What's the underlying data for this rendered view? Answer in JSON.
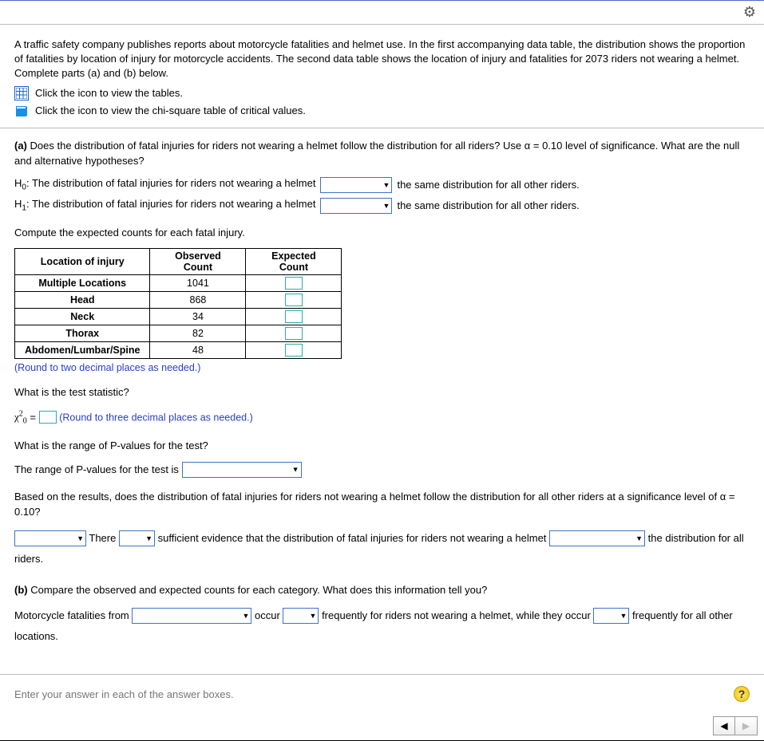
{
  "intro": {
    "text": "A traffic safety company publishes reports about motorcycle fatalities and helmet use. In the first accompanying data table, the distribution shows the proportion of fatalities by location of injury for motorcycle accidents. The second data table shows the location of injury and fatalities for 2073 riders not wearing a helmet. Complete parts (a) and (b) below.",
    "link_tables": "Click the icon to view the tables.",
    "link_chisq": "Click the icon to view the chi-square table of critical values."
  },
  "part_a": {
    "label": "(a)",
    "question": "Does the distribution of fatal injuries for riders not wearing a helmet follow the distribution for all riders? Use α = 0.10 level of significance. What are the null and alternative hypotheses?",
    "h0_prefix": "H",
    "h0_sub": "0",
    "h0_text": ": The distribution of fatal injuries for riders not wearing a helmet",
    "h0_suffix": "the same distribution for all other riders.",
    "h1_prefix": "H",
    "h1_sub": "1",
    "h1_text": ": The distribution of fatal injuries for riders not wearing a helmet",
    "h1_suffix": "the same distribution for all other riders."
  },
  "counts": {
    "heading": "Compute the expected counts for each fatal injury.",
    "headers": [
      "Location of injury",
      "Observed Count",
      "Expected Count"
    ],
    "rows": [
      {
        "loc": "Multiple Locations",
        "obs": "1041"
      },
      {
        "loc": "Head",
        "obs": "868"
      },
      {
        "loc": "Neck",
        "obs": "34"
      },
      {
        "loc": "Thorax",
        "obs": "82"
      },
      {
        "loc": "Abdomen/Lumbar/Spine",
        "obs": "48"
      }
    ],
    "round_note": "(Round to two decimal places as needed.)"
  },
  "test_stat": {
    "q": "What is the test statistic?",
    "sym_pre": "χ",
    "sup": "2",
    "sub": "0",
    "eq": " = ",
    "round_note": "(Round to three decimal places as needed.)"
  },
  "pvalue": {
    "q": "What is the range of P-values for the test?",
    "line": "The range of P-values for the test is"
  },
  "conclusion": {
    "lead": "Based on the results, does the distribution of fatal injuries for riders not wearing a helmet follow the distribution for all other riders at a significance level of α = 0.10?",
    "seg1": "There",
    "seg2": "sufficient evidence that the distribution of fatal injuries for riders not wearing a helmet",
    "seg3": "the distribution for all riders."
  },
  "part_b": {
    "label": "(b)",
    "q": "Compare the observed and expected counts for each category. What does this information tell you?",
    "seg1": "Motorcycle fatalities from",
    "seg2": "occur",
    "seg3": "frequently for riders not wearing a helmet, while they occur",
    "seg4": "frequently for all other locations."
  },
  "footer": {
    "prompt": "Enter your answer in each of the answer boxes."
  }
}
